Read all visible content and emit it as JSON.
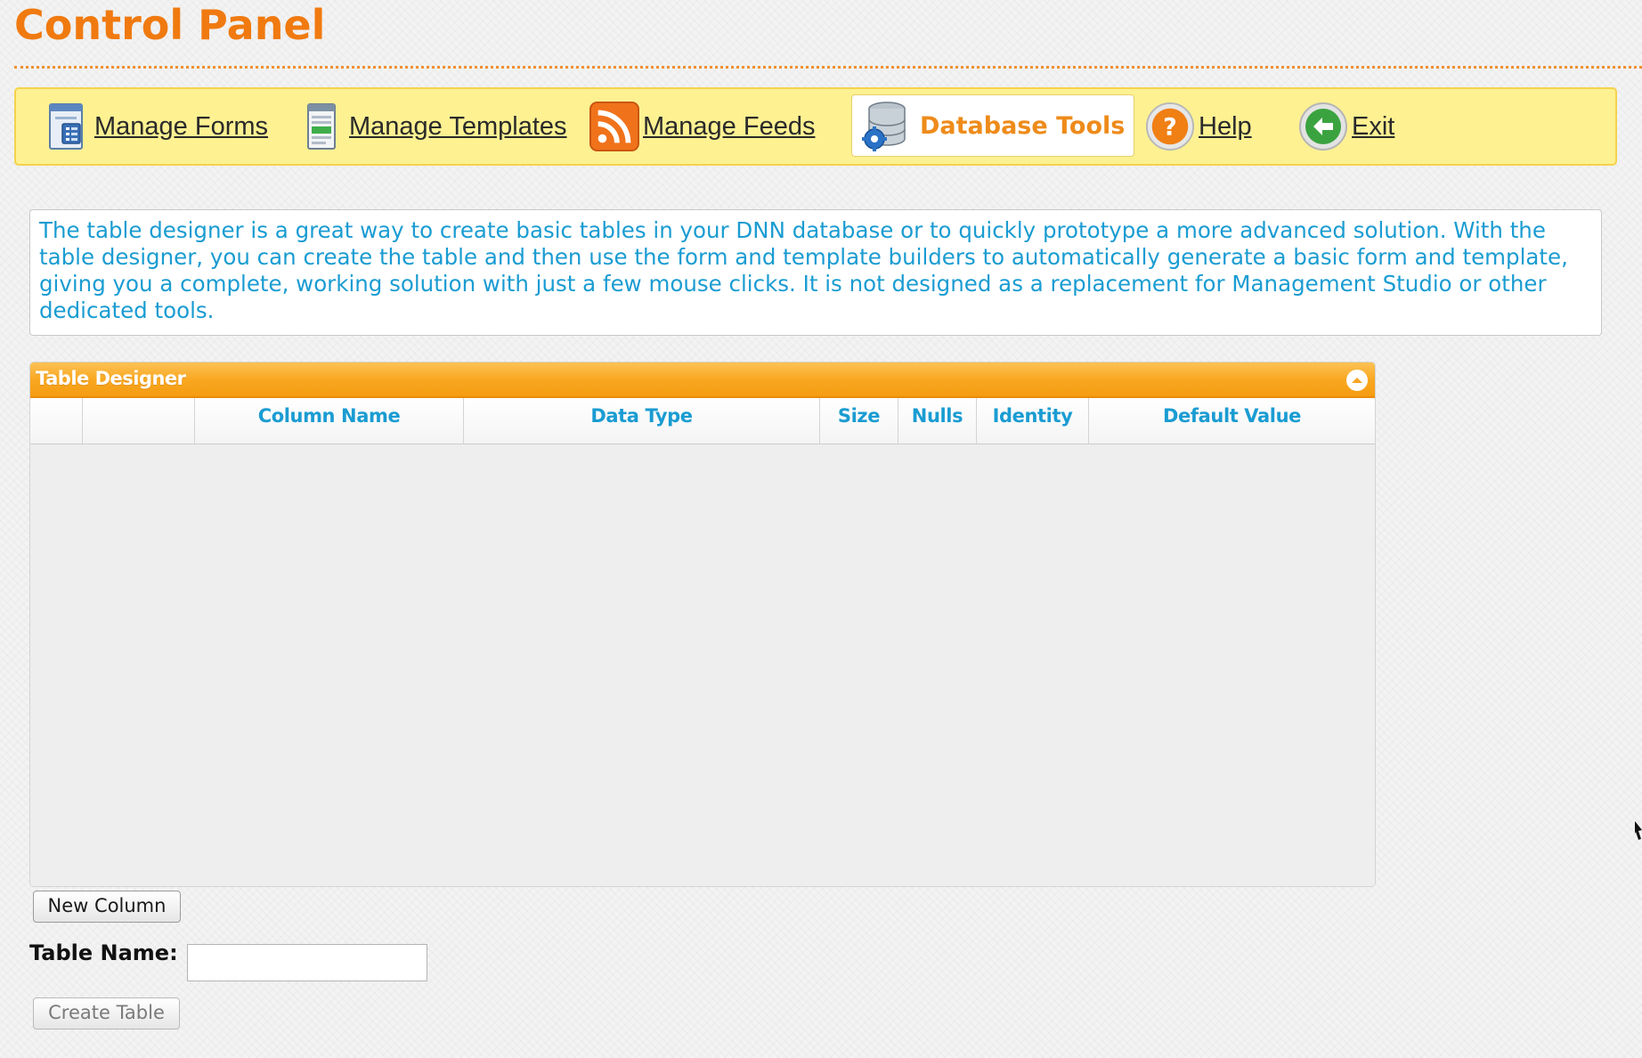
{
  "page": {
    "title": "Control Panel"
  },
  "toolbar": {
    "items": [
      {
        "label": "Manage Forms",
        "icon": "form-icon"
      },
      {
        "label": "Manage Templates",
        "icon": "template-icon"
      },
      {
        "label": "Manage Feeds",
        "icon": "rss-icon"
      },
      {
        "label": "Database Tools",
        "icon": "database-icon",
        "active": true
      },
      {
        "label": "Help",
        "icon": "help-icon"
      },
      {
        "label": "Exit",
        "icon": "exit-icon"
      }
    ]
  },
  "info": {
    "text": "The table designer is a great way to create basic tables in your DNN database or to quickly prototype a more advanced solution. With the table designer, you can create the table and then use the form and template builders to automatically generate a basic form and template, giving you a complete, working solution with just a few mouse clicks. It is not designed as a replacement for Management Studio or other dedicated tools."
  },
  "designer": {
    "title": "Table Designer",
    "columns": [
      "",
      "",
      "Column Name",
      "Data Type",
      "Size",
      "Nulls",
      "Identity",
      "Default Value"
    ],
    "rows": []
  },
  "controls": {
    "new_column_label": "New Column",
    "table_name_label": "Table Name:",
    "table_name_value": "",
    "create_table_label": "Create Table"
  },
  "colors": {
    "title": "#f07a10",
    "info_text": "#1a9cd2",
    "toolbar_bg": "#fdf192",
    "header_orange": "#f9a821",
    "active_tab_text": "#ee8b1a"
  }
}
